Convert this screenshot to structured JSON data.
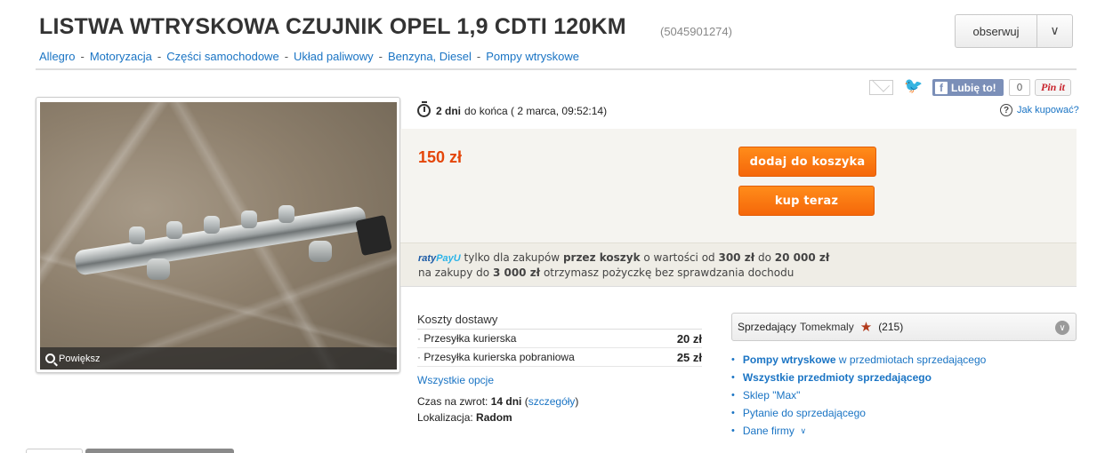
{
  "header": {
    "title": "LISTWA WTRYSKOWA CZUJNIK OPEL 1,9 CDTI 120KM",
    "item_id": "(5045901274)",
    "watch_label": "obserwuj"
  },
  "breadcrumb": [
    "Allegro",
    "Motoryzacja",
    "Części samochodowe",
    "Układ paliwowy",
    "Benzyna, Diesel",
    "Pompy wtryskowe"
  ],
  "share": {
    "fb_like": "Lubię to!",
    "fb_count": "0",
    "pinit": "Pin it"
  },
  "photo": {
    "zoom_label": "Powiększ"
  },
  "auction": {
    "ends_bold": "2 dni",
    "ends_rest": "do końca ( 2 marca, 09:52:14)",
    "help_link": "Jak kupować?",
    "price": "150 zł",
    "add_to_cart": "dodaj do koszyka",
    "buy_now": "kup teraz"
  },
  "raty": {
    "logo_part1": "raty",
    "logo_part2": "PayU",
    "line1_a": "tylko dla zakupów",
    "line1_b": "przez koszyk",
    "line1_c": "o wartości od",
    "line1_d": "300 zł",
    "line1_e": "do",
    "line1_f": "20 000 zł",
    "line2_a": "na zakupy do",
    "line2_b": "3 000 zł",
    "line2_c": "otrzymasz pożyczkę bez sprawdzania dochodu"
  },
  "delivery": {
    "title": "Koszty dostawy",
    "rows": [
      {
        "name": "Przesyłka kurierska",
        "cost": "20 zł"
      },
      {
        "name": "Przesyłka kurierska pobraniowa",
        "cost": "25 zł"
      }
    ],
    "all_options": "Wszystkie opcje",
    "return_label": "Czas na zwrot:",
    "return_value": "14 dni",
    "return_details": "szczegóły",
    "location_label": "Lokalizacja:",
    "location_value": "Radom"
  },
  "seller": {
    "label": "Sprzedający",
    "name": "Tomekmaly",
    "rating": "(215)",
    "links": [
      {
        "bold": "Pompy wtryskowe",
        "rest": "w przedmiotach sprzedającego"
      },
      {
        "bold": "Wszystkie przedmioty sprzedającego",
        "rest": ""
      },
      {
        "bold": "",
        "rest": "Sklep \"Max\""
      },
      {
        "bold": "",
        "rest": "Pytanie do sprzedającego"
      },
      {
        "bold": "",
        "rest": "Dane firmy"
      }
    ]
  },
  "colors": {
    "link": "#1a74c4",
    "price": "#e4460a",
    "button": "#f5670a"
  },
  "icons": [
    "mail-icon",
    "twitter-icon",
    "facebook-icon",
    "clock-icon",
    "help-icon",
    "zoom-icon",
    "star-icon",
    "chevron-down-icon"
  ]
}
